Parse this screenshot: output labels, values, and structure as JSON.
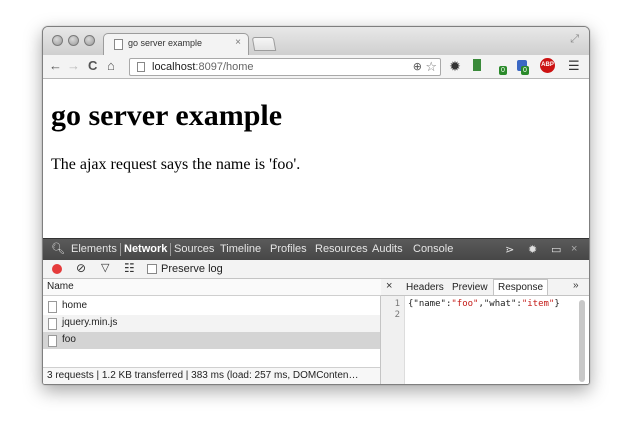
{
  "browser": {
    "tab_title": "go server example",
    "url_host": "localhost",
    "url_path": ":8097/home",
    "extension_badges": [
      "0",
      "0"
    ],
    "abp_label": "ABP"
  },
  "page": {
    "heading": "go server example",
    "paragraph": "The ajax request says the name is 'foo'."
  },
  "devtools": {
    "tabs": [
      "Elements",
      "Network",
      "Sources",
      "Timeline",
      "Profiles",
      "Resources",
      "Audits",
      "Console"
    ],
    "active_tab": "Network",
    "preserve_log_label": "Preserve log",
    "list_header": "Name",
    "requests": [
      {
        "name": "home"
      },
      {
        "name": "jquery.min.js"
      },
      {
        "name": "foo"
      }
    ],
    "status": "3 requests | 1.2 KB transferred | 383 ms (load: 257 ms, DOMConten…",
    "detail_tabs": [
      "Headers",
      "Preview",
      "Response"
    ],
    "active_detail_tab": "Response",
    "response_lines": [
      "1",
      "2"
    ],
    "response_json": {
      "open": "{",
      "k1": "\"name\"",
      "colon1": ":",
      "v1": "\"foo\"",
      "comma": ",",
      "k2": "\"what\"",
      "colon2": ":",
      "v2": "\"item\"",
      "close": "}"
    }
  }
}
